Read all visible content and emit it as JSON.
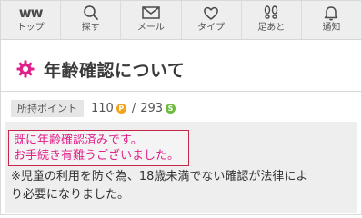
{
  "nav": {
    "logo_text": "ww",
    "items": [
      {
        "label": "トップ",
        "icon": "ww-logo-icon"
      },
      {
        "label": "探す",
        "icon": "search-icon"
      },
      {
        "label": "メール",
        "icon": "mail-icon"
      },
      {
        "label": "タイプ",
        "icon": "heart-icon"
      },
      {
        "label": "足あと",
        "icon": "footprints-icon"
      },
      {
        "label": "通知",
        "icon": "bell-icon"
      }
    ]
  },
  "page": {
    "title": "年齢確認について",
    "title_icon": "gear-icon",
    "accent_color": "#e0218a"
  },
  "points": {
    "label": "所持ポイント",
    "point_value": "110",
    "point_badge": "P",
    "sub_value": "293",
    "sub_badge": "S",
    "separator": "/"
  },
  "notice": {
    "alert_line1": "既に年齢確認済みです。",
    "alert_line2": "お手続き有難うございました。",
    "desc_line1": "※児童の利用を防ぐ為、18歳未満でない確認が法律によ",
    "desc_line2": "り必要になりました。"
  }
}
